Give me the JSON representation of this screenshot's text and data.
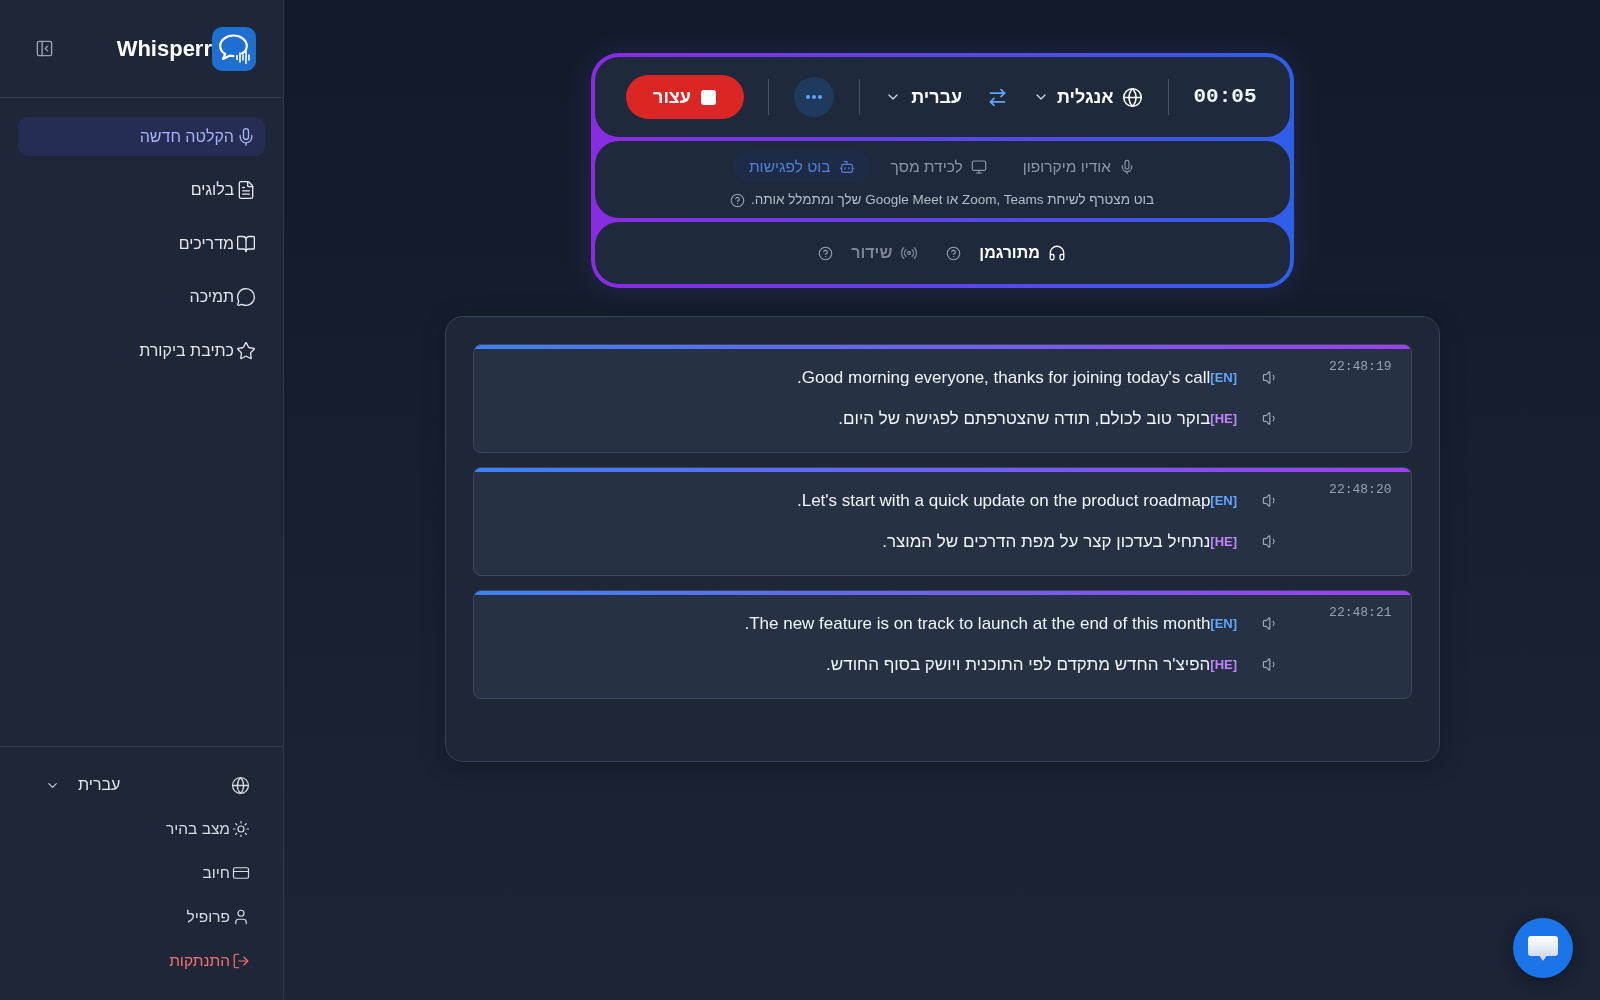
{
  "sidebar": {
    "app_name": "Whisperr",
    "nav": [
      {
        "label": "הקלטה חדשה",
        "selected": true
      },
      {
        "label": "בלוגים",
        "selected": false
      },
      {
        "label": "מדריכים",
        "selected": false
      },
      {
        "label": "תמיכה",
        "selected": false
      },
      {
        "label": "כתיבת ביקורת",
        "selected": false
      }
    ],
    "language": "עברית",
    "menu": [
      {
        "label": "מצב בהיר",
        "kind": "normal"
      },
      {
        "label": "חיוב",
        "kind": "normal"
      },
      {
        "label": "פרופיל",
        "kind": "normal"
      },
      {
        "label": "התנתקות",
        "kind": "danger"
      }
    ]
  },
  "recorder": {
    "timer": "00:05",
    "source_language": "אנגלית",
    "target_language": "עברית",
    "stop_button": "עצור",
    "sources": [
      {
        "label": "אודיו מיקרופון",
        "selected": false
      },
      {
        "label": "לכידת מסך",
        "selected": false
      },
      {
        "label": "בוט לפגישות",
        "selected": true
      }
    ],
    "source_hint": "בוט מצטרף לשיחת Zoom, Teams או Google Meet שלך ומתמלל אותה.",
    "modes": [
      {
        "label": "מתורגמן",
        "selected": true
      },
      {
        "label": "שידור",
        "selected": false
      }
    ]
  },
  "transcript": [
    {
      "time": "22:48:19",
      "lines": [
        {
          "tag": "[EN]",
          "color": "#60a5fa",
          "text": "Good morning everyone, thanks for joining today's call."
        },
        {
          "tag": "[HE]",
          "color": "#c084fc",
          "text": "בוקר טוב לכולם, תודה שהצטרפתם לפגישה של היום."
        }
      ]
    },
    {
      "time": "22:48:20",
      "lines": [
        {
          "tag": "[EN]",
          "color": "#60a5fa",
          "text": "Let's start with a quick update on the product roadmap."
        },
        {
          "tag": "[HE]",
          "color": "#c084fc",
          "text": "נתחיל בעדכון קצר על מפת הדרכים של המוצר."
        }
      ]
    },
    {
      "time": "22:48:21",
      "lines": [
        {
          "tag": "[EN]",
          "color": "#60a5fa",
          "text": "The new feature is on track to launch at the end of this month."
        },
        {
          "tag": "[HE]",
          "color": "#c084fc",
          "text": "הפיצ'ר החדש מתקדם לפי התוכנית ויושק בסוף החודש."
        }
      ]
    }
  ]
}
